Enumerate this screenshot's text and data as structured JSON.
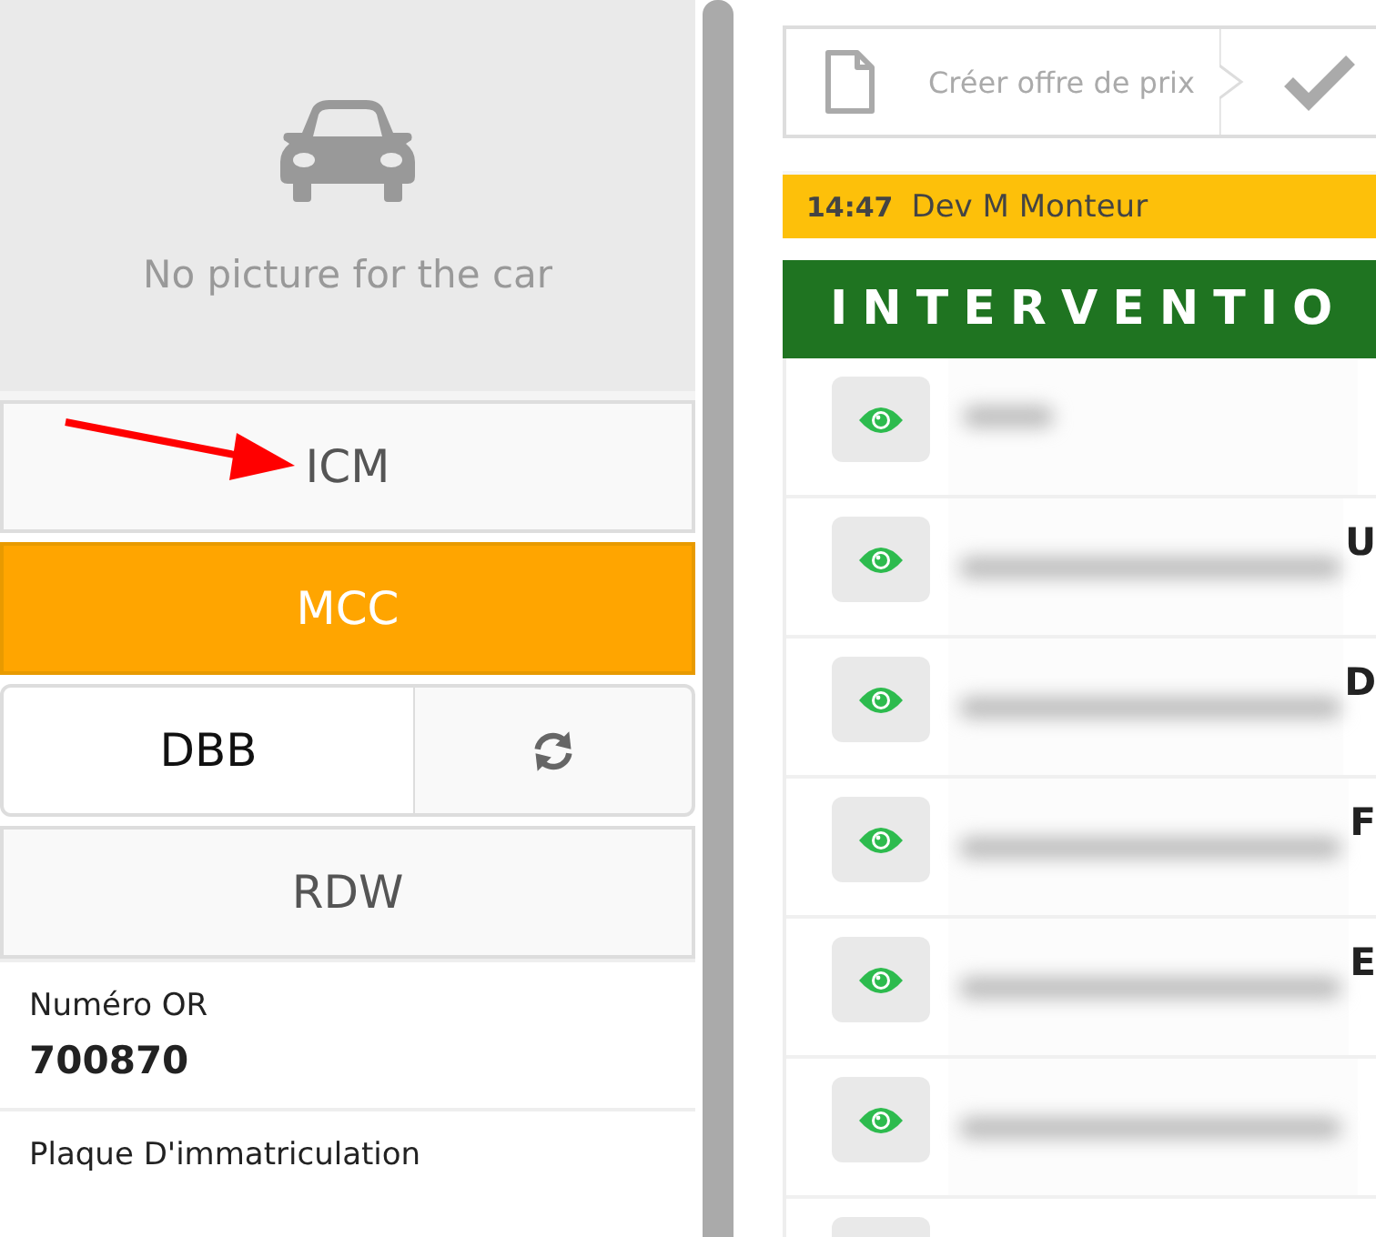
{
  "vehicle_panel": {
    "no_picture_text": "No picture for the car"
  },
  "source_buttons": [
    {
      "label": "ICM",
      "kind": "plain",
      "selected": false
    },
    {
      "label": "MCC",
      "kind": "plain",
      "selected": true
    },
    {
      "label": "DBB",
      "kind": "split",
      "selected": false
    },
    {
      "label": "RDW",
      "kind": "plain",
      "selected": false
    }
  ],
  "fields": [
    {
      "label": "Numéro OR",
      "value": "700870"
    },
    {
      "label": "Plaque D'immatriculation"
    }
  ],
  "toolbar": {
    "steps": [
      {
        "label": "Créer offre de prix",
        "kind": "document"
      },
      {
        "kind": "check"
      }
    ]
  },
  "status_bar": {
    "time": "14:47",
    "text": "Dev M Monteur"
  },
  "section_header": "INTERVENTIO",
  "rows": [
    {
      "kind": "short"
    },
    {
      "kind": "long",
      "edge_text": "U"
    },
    {
      "kind": "long",
      "edge_text": "D"
    },
    {
      "kind": "long",
      "edge_text": "F"
    },
    {
      "kind": "long",
      "edge_text": "E"
    },
    {
      "kind": "long"
    },
    {
      "kind": "empty"
    }
  ]
}
